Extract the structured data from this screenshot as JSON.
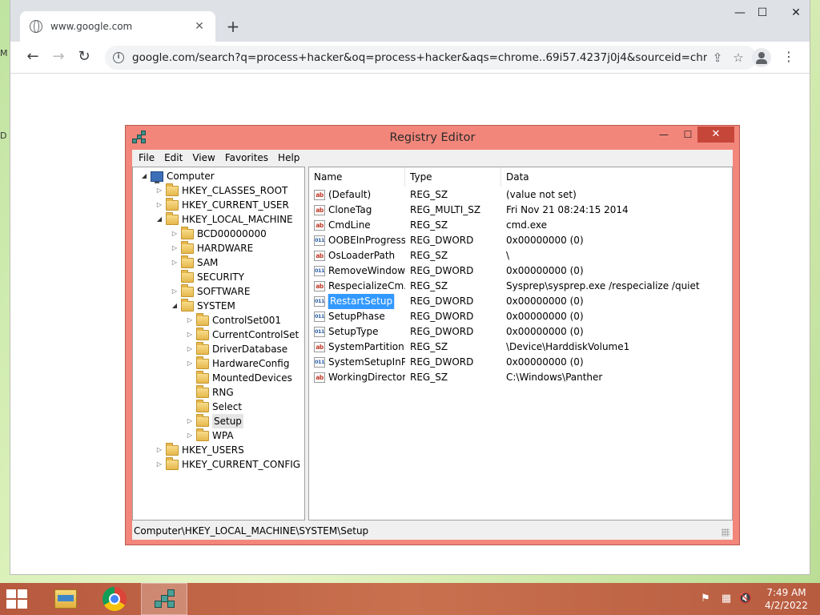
{
  "desktop": {
    "edge_glyphs": [
      "M",
      "D"
    ]
  },
  "browser": {
    "tab_title": "www.google.com",
    "tab_close": "✕",
    "new_tab": "+",
    "window_controls": {
      "minimize": "—",
      "maximize": "☐",
      "close": "✕"
    },
    "url": "google.com/search?q=process+hacker&oq=process+hacker&aqs=chrome..69i57.4237j0j4&sourceid=chrome&...",
    "icons": [
      "back-arrow-icon",
      "forward-arrow-icon",
      "reload-icon",
      "info-icon",
      "share-icon",
      "star-icon",
      "profile-icon",
      "kebab-menu-icon"
    ]
  },
  "regedit": {
    "title": "Registry Editor",
    "controls": {
      "minimize": "—",
      "maximize": "☐",
      "close": "✕"
    },
    "menu": [
      "File",
      "Edit",
      "View",
      "Favorites",
      "Help"
    ],
    "tree": [
      {
        "label": "Computer",
        "depth": 0,
        "expander": "open",
        "icon": "computer"
      },
      {
        "label": "HKEY_CLASSES_ROOT",
        "depth": 1,
        "expander": "closed"
      },
      {
        "label": "HKEY_CURRENT_USER",
        "depth": 1,
        "expander": "closed"
      },
      {
        "label": "HKEY_LOCAL_MACHINE",
        "depth": 1,
        "expander": "open"
      },
      {
        "label": "BCD00000000",
        "depth": 2,
        "expander": "closed"
      },
      {
        "label": "HARDWARE",
        "depth": 2,
        "expander": "closed"
      },
      {
        "label": "SAM",
        "depth": 2,
        "expander": "closed"
      },
      {
        "label": "SECURITY",
        "depth": 2,
        "expander": "none"
      },
      {
        "label": "SOFTWARE",
        "depth": 2,
        "expander": "closed"
      },
      {
        "label": "SYSTEM",
        "depth": 2,
        "expander": "open"
      },
      {
        "label": "ControlSet001",
        "depth": 3,
        "expander": "closed"
      },
      {
        "label": "CurrentControlSet",
        "depth": 3,
        "expander": "closed"
      },
      {
        "label": "DriverDatabase",
        "depth": 3,
        "expander": "closed"
      },
      {
        "label": "HardwareConfig",
        "depth": 3,
        "expander": "closed"
      },
      {
        "label": "MountedDevices",
        "depth": 3,
        "expander": "none"
      },
      {
        "label": "RNG",
        "depth": 3,
        "expander": "none"
      },
      {
        "label": "Select",
        "depth": 3,
        "expander": "none"
      },
      {
        "label": "Setup",
        "depth": 3,
        "expander": "closed",
        "selected": true
      },
      {
        "label": "WPA",
        "depth": 3,
        "expander": "closed"
      },
      {
        "label": "HKEY_USERS",
        "depth": 1,
        "expander": "closed"
      },
      {
        "label": "HKEY_CURRENT_CONFIG",
        "depth": 1,
        "expander": "closed"
      }
    ],
    "columns": [
      "Name",
      "Type",
      "Data"
    ],
    "values": [
      {
        "name": "(Default)",
        "type": "REG_SZ",
        "data": "(value not set)",
        "icon": "string"
      },
      {
        "name": "CloneTag",
        "type": "REG_MULTI_SZ",
        "data": "Fri Nov 21 08:24:15 2014",
        "icon": "string"
      },
      {
        "name": "CmdLine",
        "type": "REG_SZ",
        "data": "cmd.exe",
        "icon": "string"
      },
      {
        "name": "OOBEInProgress",
        "type": "REG_DWORD",
        "data": "0x00000000 (0)",
        "icon": "binary"
      },
      {
        "name": "OsLoaderPath",
        "type": "REG_SZ",
        "data": "\\",
        "icon": "string"
      },
      {
        "name": "RemoveWindow...",
        "type": "REG_DWORD",
        "data": "0x00000000 (0)",
        "icon": "binary"
      },
      {
        "name": "RespecializeCm...",
        "type": "REG_SZ",
        "data": "Sysprep\\sysprep.exe /respecialize /quiet",
        "icon": "string"
      },
      {
        "name": "RestartSetup",
        "type": "REG_DWORD",
        "data": "0x00000000 (0)",
        "icon": "binary",
        "selected": true
      },
      {
        "name": "SetupPhase",
        "type": "REG_DWORD",
        "data": "0x00000000 (0)",
        "icon": "binary"
      },
      {
        "name": "SetupType",
        "type": "REG_DWORD",
        "data": "0x00000000 (0)",
        "icon": "binary"
      },
      {
        "name": "SystemPartition",
        "type": "REG_SZ",
        "data": "\\Device\\HarddiskVolume1",
        "icon": "string"
      },
      {
        "name": "SystemSetupInP...",
        "type": "REG_DWORD",
        "data": "0x00000000 (0)",
        "icon": "binary"
      },
      {
        "name": "WorkingDirectory",
        "type": "REG_SZ",
        "data": "C:\\Windows\\Panther",
        "icon": "string"
      }
    ],
    "icon_glyphs": {
      "string": "ab",
      "binary": "011"
    },
    "status_path": "Computer\\HKEY_LOCAL_MACHINE\\SYSTEM\\Setup"
  },
  "taskbar": {
    "items": [
      "file-explorer",
      "google-chrome",
      "registry-editor"
    ],
    "active": "registry-editor",
    "clock": {
      "time": "7:49 AM",
      "date": "4/2/2022"
    },
    "tray_icons": [
      "action-center-flag-icon",
      "network-icon",
      "volume-muted-icon"
    ]
  }
}
